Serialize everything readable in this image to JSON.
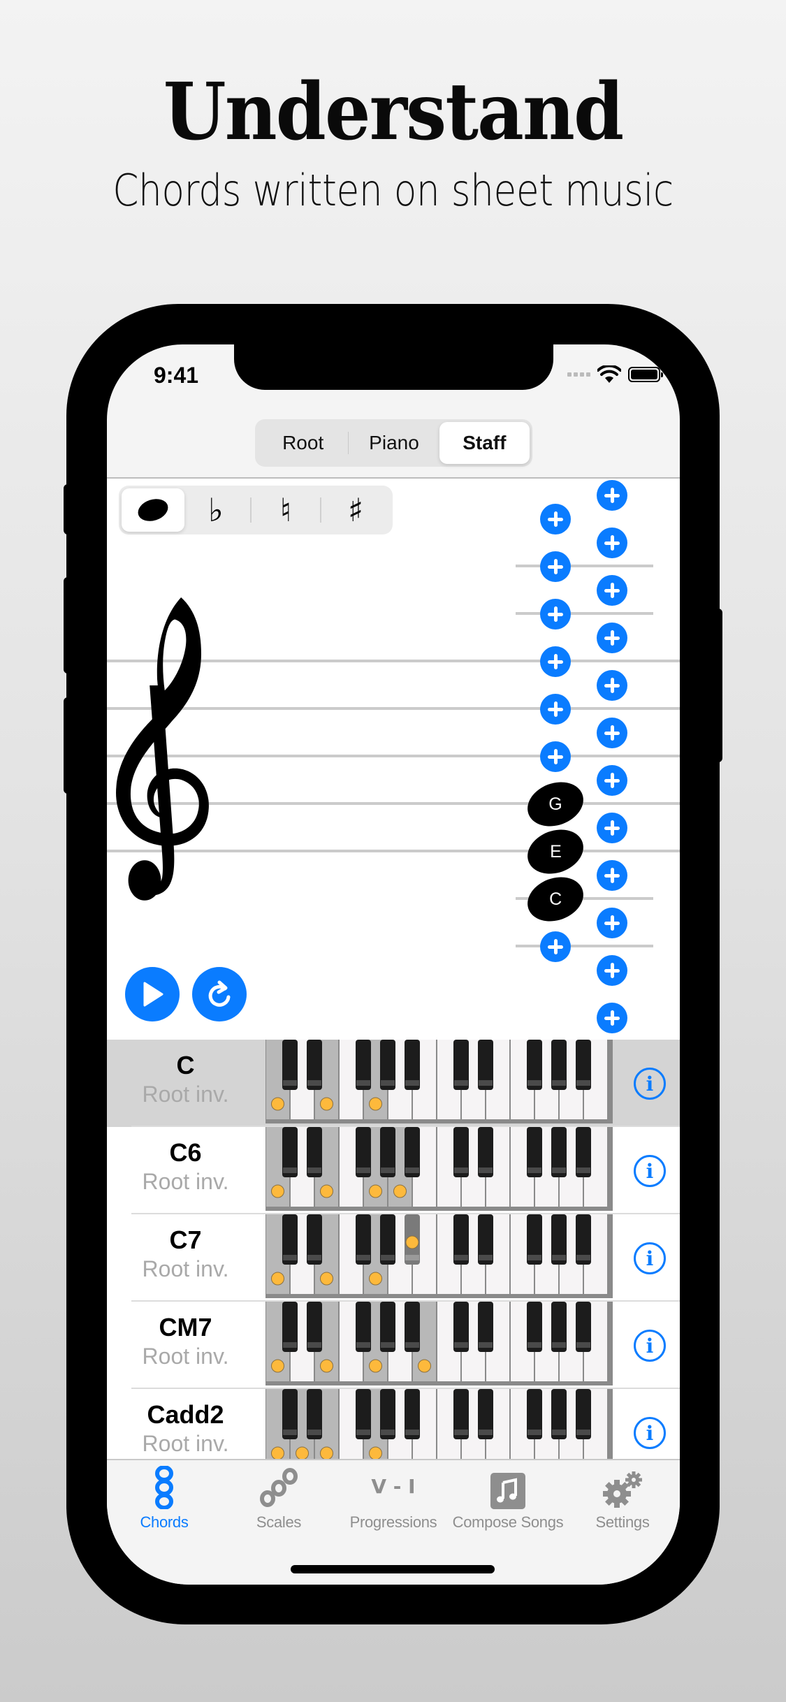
{
  "promo": {
    "headline": "Understand",
    "subheadline": "Chords written on sheet music"
  },
  "status_bar": {
    "time": "9:41",
    "icons": [
      "cellular-signal-icon",
      "wifi-icon",
      "battery-icon"
    ]
  },
  "view_mode": {
    "options": [
      "Root",
      "Piano",
      "Staff"
    ],
    "selected": "Staff"
  },
  "note_toolbar": {
    "items": [
      {
        "name": "note",
        "glyph": ""
      },
      {
        "name": "flat",
        "glyph": "♭"
      },
      {
        "name": "natural",
        "glyph": "♮"
      },
      {
        "name": "sharp",
        "glyph": "♯"
      }
    ],
    "selected": "note"
  },
  "staff": {
    "clef": "treble",
    "notes": [
      "G",
      "E",
      "C"
    ],
    "add_note_buttons_left_count": 7,
    "add_note_buttons_right_count": 12
  },
  "playback": {
    "play_icon": "play-icon",
    "repeat_icon": "repeat-icon"
  },
  "chords": [
    {
      "name": "C",
      "inversion": "Root inv.",
      "selected": true,
      "keys": [
        0,
        4,
        7
      ]
    },
    {
      "name": "C6",
      "inversion": "Root inv.",
      "selected": false,
      "keys": [
        0,
        4,
        7,
        9
      ]
    },
    {
      "name": "C7",
      "inversion": "Root inv.",
      "selected": false,
      "keys": [
        0,
        4,
        7,
        10
      ]
    },
    {
      "name": "CM7",
      "inversion": "Root inv.",
      "selected": false,
      "keys": [
        0,
        4,
        7,
        11
      ]
    },
    {
      "name": "Cadd2",
      "inversion": "Root inv.",
      "selected": false,
      "keys": [
        0,
        2,
        4,
        7
      ]
    }
  ],
  "tabbar": {
    "items": [
      {
        "label": "Chords",
        "icon": "chords-icon",
        "active": true
      },
      {
        "label": "Scales",
        "icon": "scales-icon",
        "active": false
      },
      {
        "label": "Progressions",
        "icon": "progressions-icon",
        "icon_text": "V - I",
        "active": false
      },
      {
        "label": "Compose Songs",
        "icon": "music-note-icon",
        "active": false
      },
      {
        "label": "Settings",
        "icon": "gears-icon",
        "active": false
      }
    ]
  },
  "colors": {
    "accent": "#0a7cff",
    "key_dot": "#fdb93c",
    "highlight_row": "#d4d4d4",
    "secondary_text": "#a9a9a9"
  }
}
